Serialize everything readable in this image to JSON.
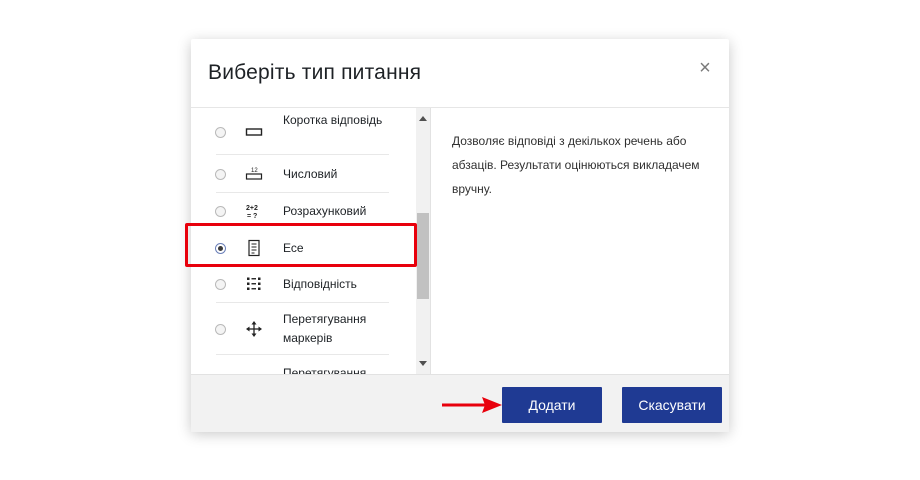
{
  "dialog": {
    "title": "Виберіть тип питання",
    "close_symbol": "×",
    "options": [
      {
        "label": "Коротка відповідь",
        "icon": "short-answer-icon",
        "selected": false
      },
      {
        "label": "Числовий",
        "icon": "numerical-icon",
        "selected": false
      },
      {
        "label": "Розрахунковий",
        "icon": "calculated-icon",
        "selected": false
      },
      {
        "label": "Есе",
        "icon": "essay-icon",
        "selected": true
      },
      {
        "label": "Відповідність",
        "icon": "matching-icon",
        "selected": false
      },
      {
        "label": "Перетягування маркерів",
        "icon": "drag-markers-icon",
        "selected": false
      },
      {
        "label": "Перетягування",
        "icon": "",
        "selected": false
      }
    ],
    "description": "Дозволяє відповіді з декількох речень або абзаців. Результати оцінюються викладачем вручну.",
    "add_button": "Додати",
    "cancel_button": "Скасувати",
    "icon_text": {
      "numerical": "12",
      "calc_top": "2+2",
      "calc_bottom": "= ?"
    }
  },
  "annotations": {
    "highlight_color": "#e8000c",
    "arrow_color": "#e8000c"
  },
  "colors": {
    "button": "#1f3a93",
    "footer": "#f2f2f2"
  }
}
